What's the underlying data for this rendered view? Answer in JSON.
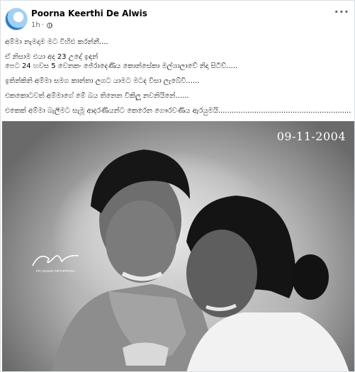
{
  "post": {
    "author": "Poorna Keerthi De Alwis",
    "time": "1h",
    "privacy_icon": "globe-icon",
    "more_icon": "more-options-icon",
    "lines": [
      "අම්මා නැමදාම මට විහිළු කරන්නී....",
      "ඒ නිසාම එයා අද 23 උදේ ඉඳන්\nපෙට 24 හවස 5 වෙනකං  ජේරාදෙණිය කොන්සේකා මල්ශාලාවේ නිදා සිටිව්.....",
      "ඉතින්කිනි අම්මා සමග කාන්තා ලගට යාමට මටද විසා ලැබේවි......",
      "එකකොටවත් අම්මාගේ මේ බය තිනෙන විකිලූ නවනියිනේ......",
      "එකෙක් අම්මා බැලීමට සැමූ ආදරණියන්ට කෙරෙන ගෞරවණිය ඇරයුමයි.................................................................."
    ]
  },
  "photo": {
    "date_stamp": "09-11-2004",
    "signature_credit": "PIC  DASUN PIETHPRAGA"
  }
}
